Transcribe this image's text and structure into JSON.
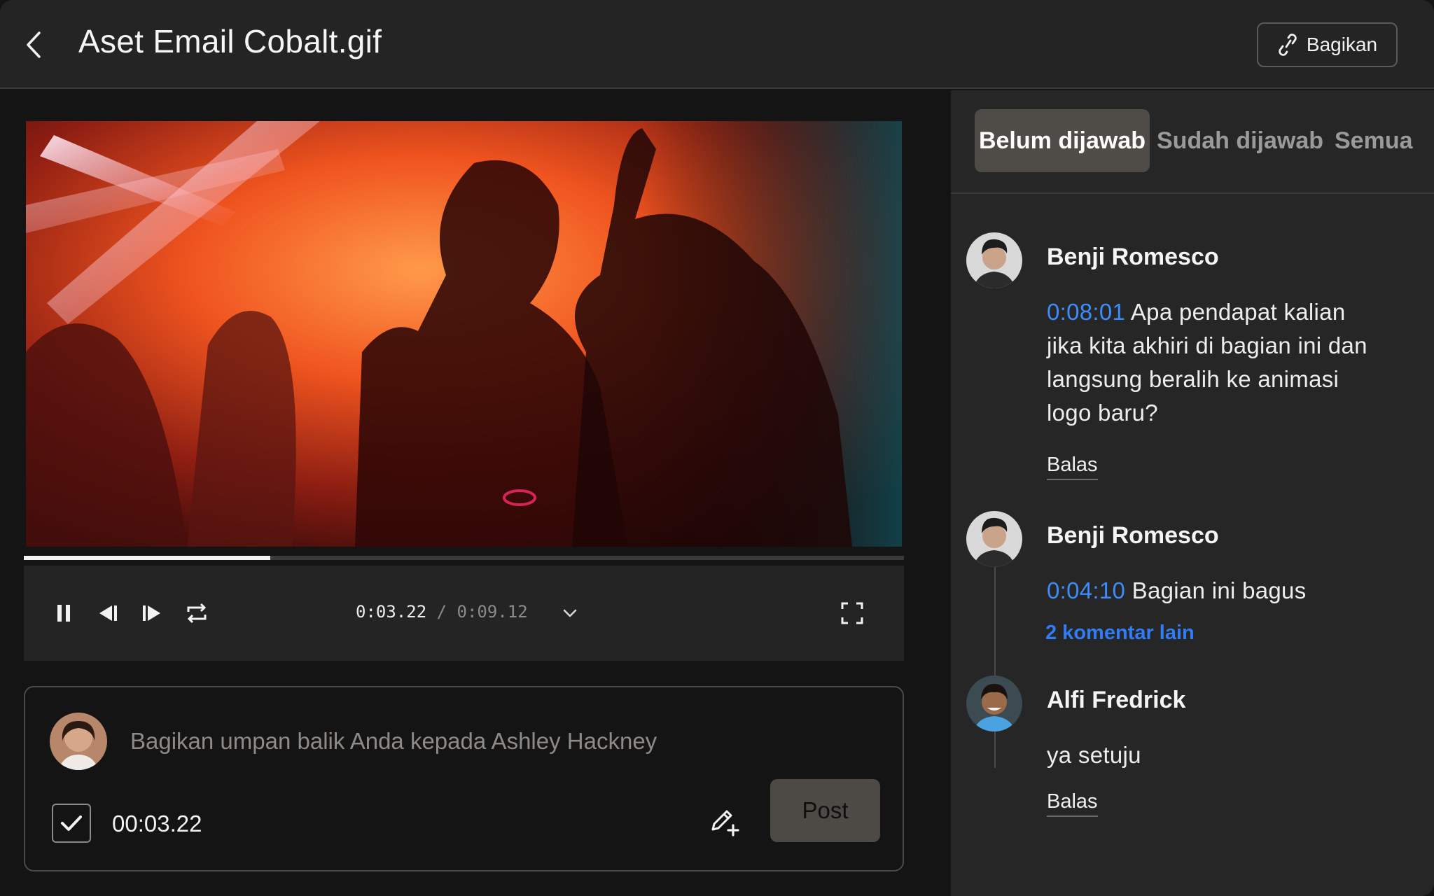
{
  "header": {
    "title": "Aset Email Cobalt.gif",
    "share_label": "Bagikan"
  },
  "player": {
    "current_time": "0:03.22",
    "separator": "/",
    "total_time": "0:09.12",
    "progress": 0.28
  },
  "composer": {
    "placeholder": "Bagikan umpan balik Anda kepada Ashley Hackney",
    "timestamp": "00:03.22",
    "post_label": "Post"
  },
  "tabs": [
    {
      "label": "Belum dijawab",
      "active": true
    },
    {
      "label": "Sudah dijawab",
      "active": false
    },
    {
      "label": "Semua",
      "active": false
    }
  ],
  "comments": [
    {
      "author": "Benji Romesco",
      "timecode": "0:08:01",
      "text": " Apa pendapat kalian jika kita akhiri di bagian ini dan langsung beralih ke animasi logo baru?",
      "reply_label": "Balas"
    },
    {
      "author": "Benji Romesco",
      "timecode": "0:04:10",
      "text": " Bagian ini bagus",
      "more_label": "2 komentar lain"
    },
    {
      "author": "Alfi Fredrick",
      "text": "ya setuju",
      "reply_label": "Balas"
    }
  ],
  "colors": {
    "link_blue": "#2f7cf6",
    "timecode_blue": "#3d8cff",
    "sidebar_bg": "#262626",
    "header_bg": "#242424"
  }
}
